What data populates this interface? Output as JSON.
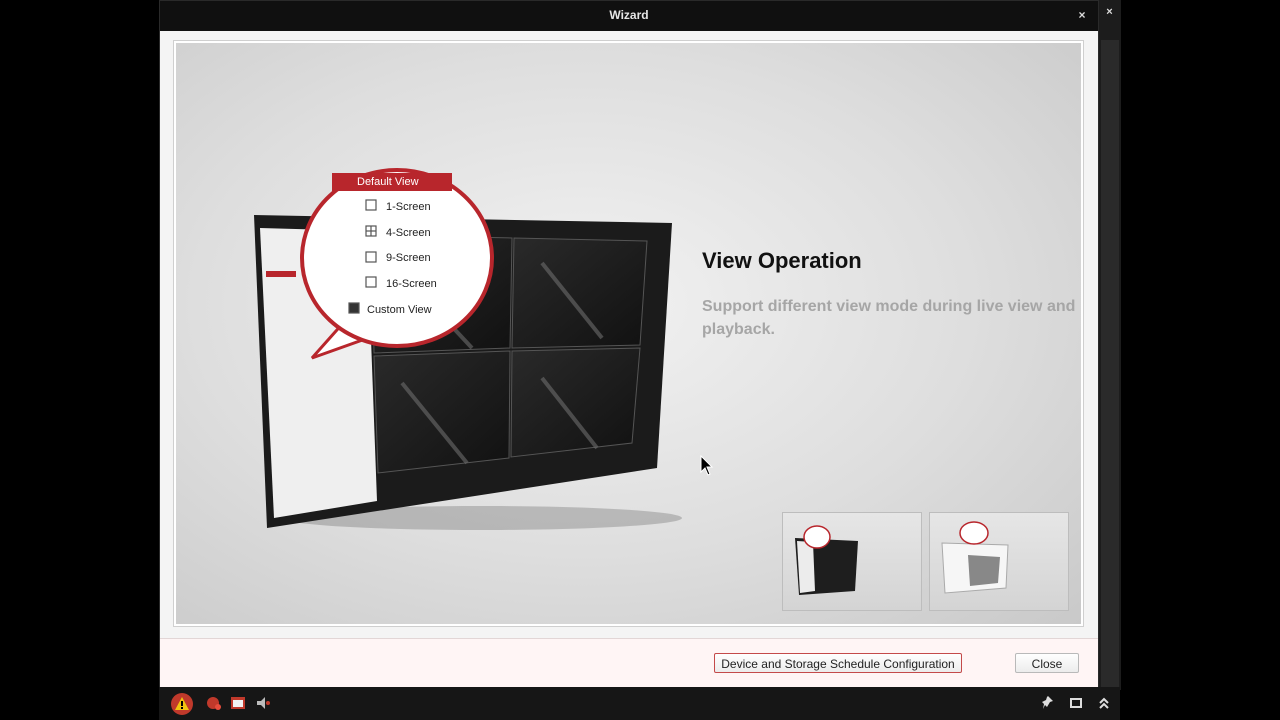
{
  "window": {
    "title": "Wizard",
    "close_glyph": "×"
  },
  "right_pane": {
    "close_glyph": "×"
  },
  "slide": {
    "heading": "View Operation",
    "description": "Support different view mode during live view and playback.",
    "menu": {
      "title": "Default View",
      "items": [
        "1-Screen",
        "4-Screen",
        "9-Screen",
        "16-Screen"
      ],
      "custom": "Custom View"
    }
  },
  "footer": {
    "config_button": "Device and Storage Schedule Configuration",
    "close_button": "Close"
  },
  "taskbar": {
    "icons": [
      "alarm-warning-icon",
      "record-icon",
      "event-icon",
      "audio-icon",
      "pin-icon",
      "window-icon",
      "collapse-up-icon"
    ]
  },
  "colors": {
    "accent": "#b8262c",
    "titlebar": "#101010",
    "muted_text": "#a6a6a6"
  }
}
